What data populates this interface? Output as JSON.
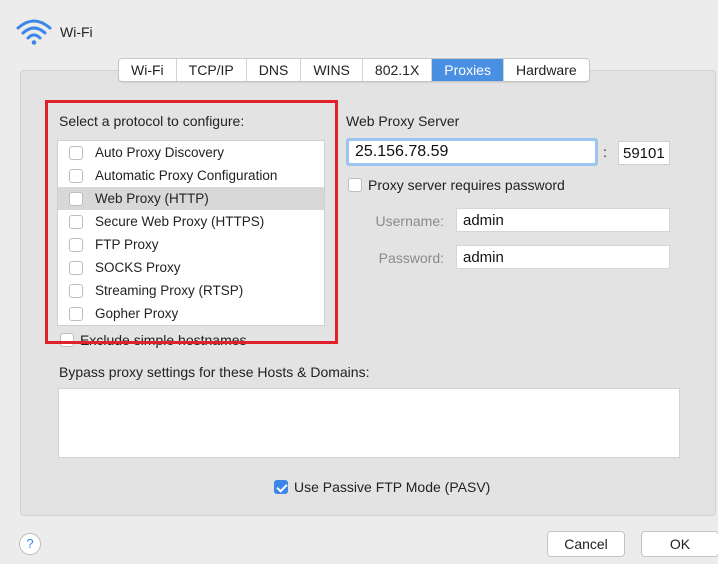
{
  "header": {
    "title": "Wi-Fi",
    "icon": "wifi-icon"
  },
  "tabs": [
    {
      "label": "Wi-Fi",
      "active": false
    },
    {
      "label": "TCP/IP",
      "active": false
    },
    {
      "label": "DNS",
      "active": false
    },
    {
      "label": "WINS",
      "active": false
    },
    {
      "label": "802.1X",
      "active": false
    },
    {
      "label": "Proxies",
      "active": true
    },
    {
      "label": "Hardware",
      "active": false
    }
  ],
  "protocols": {
    "label": "Select a protocol to configure:",
    "items": [
      {
        "label": "Auto Proxy Discovery",
        "checked": false,
        "selected": false
      },
      {
        "label": "Automatic Proxy Configuration",
        "checked": false,
        "selected": false
      },
      {
        "label": "Web Proxy (HTTP)",
        "checked": false,
        "selected": true
      },
      {
        "label": "Secure Web Proxy (HTTPS)",
        "checked": false,
        "selected": false
      },
      {
        "label": "FTP Proxy",
        "checked": false,
        "selected": false
      },
      {
        "label": "SOCKS Proxy",
        "checked": false,
        "selected": false
      },
      {
        "label": "Streaming Proxy (RTSP)",
        "checked": false,
        "selected": false
      },
      {
        "label": "Gopher Proxy",
        "checked": false,
        "selected": false
      }
    ],
    "exclude_label": "Exclude simple hostnames"
  },
  "proxy": {
    "label": "Web Proxy Server",
    "server": "25.156.78.59",
    "colon": ":",
    "port": "59101",
    "requires_password_label": "Proxy server requires password",
    "username_label": "Username:",
    "username": "admin",
    "password_label": "Password:",
    "password": "admin"
  },
  "bypass": {
    "label": "Bypass proxy settings for these Hosts & Domains:",
    "value": ""
  },
  "pasv": {
    "label": "Use Passive FTP Mode (PASV)",
    "checked": true
  },
  "footer": {
    "help": "?",
    "cancel": "Cancel",
    "ok": "OK"
  },
  "colors": {
    "accent": "#3b86e8",
    "highlight": "#e0202a",
    "tab_active": "#4a90e2"
  }
}
